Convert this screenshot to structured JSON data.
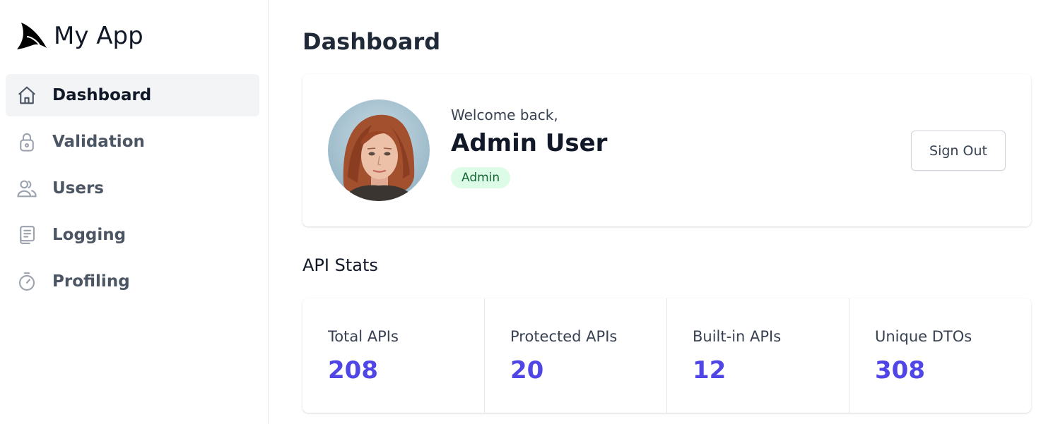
{
  "app": {
    "name": "My App"
  },
  "sidebar": {
    "items": [
      {
        "label": "Dashboard",
        "icon": "home-icon",
        "active": true
      },
      {
        "label": "Validation",
        "icon": "lock-icon",
        "active": false
      },
      {
        "label": "Users",
        "icon": "users-icon",
        "active": false
      },
      {
        "label": "Logging",
        "icon": "log-icon",
        "active": false
      },
      {
        "label": "Profiling",
        "icon": "stopwatch-icon",
        "active": false
      }
    ]
  },
  "main": {
    "title": "Dashboard",
    "profile": {
      "welcome": "Welcome back,",
      "name": "Admin User",
      "role": "Admin",
      "sign_out_label": "Sign Out"
    },
    "stats_title": "API Stats",
    "stats": [
      {
        "label": "Total APIs",
        "value": "208"
      },
      {
        "label": "Protected APIs",
        "value": "20"
      },
      {
        "label": "Built-in APIs",
        "value": "12"
      },
      {
        "label": "Unique DTOs",
        "value": "308"
      }
    ]
  },
  "colors": {
    "accent": "#4f46e5",
    "badge_bg": "#dcfce7",
    "badge_text": "#166534",
    "active_nav_bg": "#f3f4f6"
  }
}
